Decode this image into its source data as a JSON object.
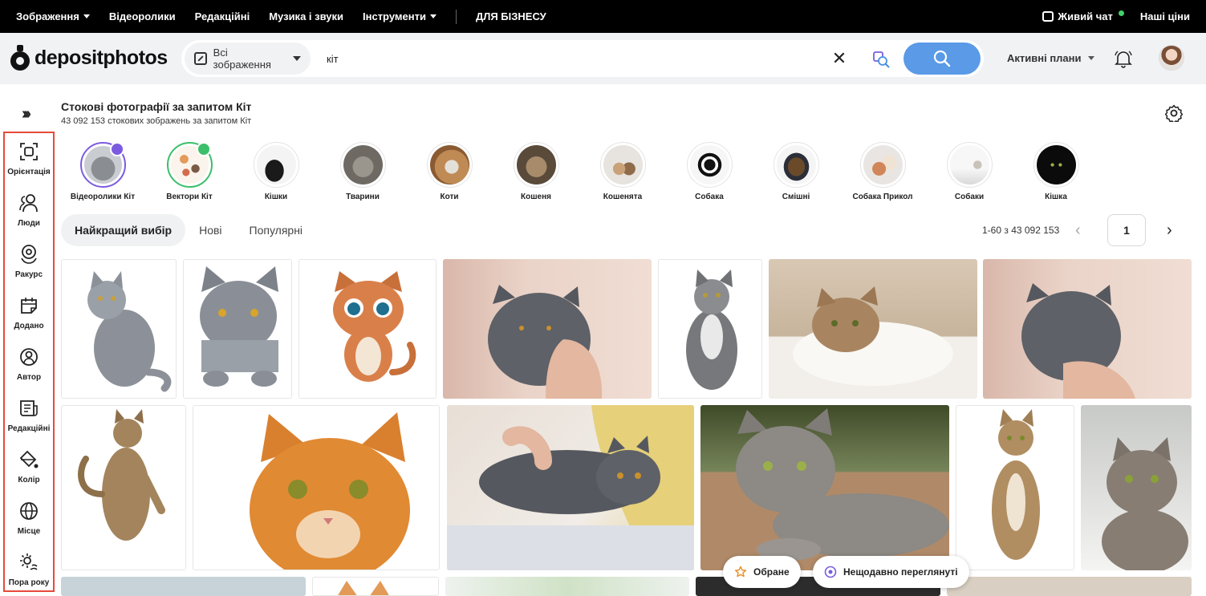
{
  "topbar": {
    "nav": [
      "Зображення",
      "Відеоролики",
      "Редакційні",
      "Музика і звуки",
      "Інструменти",
      "ДЛЯ БІЗНЕСУ"
    ],
    "live_chat": "Живий чат",
    "prices": "Наші ціни"
  },
  "header": {
    "logo": "depositphotos",
    "scope": "Всі зображення",
    "query": "кіт",
    "plans": "Активні плани"
  },
  "page": {
    "title": "Стокові фотографії за запитом Кіт",
    "subtitle": "43 092 153 стокових зображень за запитом Кіт"
  },
  "sidebar": {
    "filters": [
      "Орієнтація",
      "Люди",
      "Ракурс",
      "Додано",
      "Автор",
      "Редакційні",
      "Колір",
      "Місце",
      "Пора року"
    ]
  },
  "suggestions": [
    "Відеоролики Кіт",
    "Вектори Кіт",
    "Кішки",
    "Тварини",
    "Коти",
    "Кошеня",
    "Кошенята",
    "Собака",
    "Смішні",
    "Собака Прикол",
    "Собаки",
    "Кішка"
  ],
  "tabs": [
    "Найкращий вибір",
    "Нові",
    "Популярні"
  ],
  "pagination": {
    "range": "1-60 з 43 092 153",
    "page": "1"
  },
  "floating": {
    "favorites": "Обране",
    "recent": "Нещодавно переглянуті"
  },
  "colors": {
    "search_button": "#5a9ae6",
    "highlight_border": "#e54a3b",
    "online": "#3fd26b"
  }
}
